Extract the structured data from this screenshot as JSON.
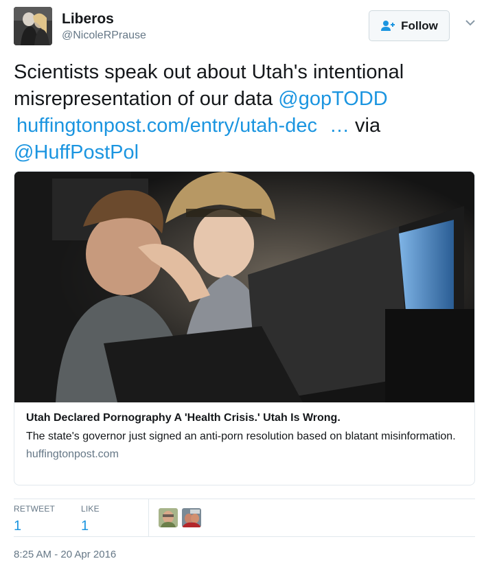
{
  "author": {
    "display_name": "Liberos",
    "handle": "@NicoleRPrause",
    "avatar_icon": "profile-photo-icon"
  },
  "follow": {
    "label": "Follow",
    "icon": "follow-person-plus-icon"
  },
  "tweet": {
    "text_1": "Scientists speak out about Utah's intentional misrepresentation of our data ",
    "mention_1": "@gopTODD",
    "url": "huffingtonpost.com/entry/utah-dec",
    "ellipsis": "…",
    "via": " via ",
    "mention_2": "@HuffPostPol"
  },
  "card": {
    "title": "Utah Declared Pornography A 'Health Crisis.' Utah Is Wrong.",
    "description": "The state's governor just signed an anti-porn resolution based on blatant misinformation.",
    "domain": "huffingtonpost.com"
  },
  "stats": {
    "retweet_label": "RETWEET",
    "retweet_count": "1",
    "like_label": "LIKE",
    "like_count": "1"
  },
  "timestamp": "8:25 AM - 20 Apr 2016",
  "colors": {
    "link": "#1b95e0",
    "text": "#14171a",
    "secondary": "#657786",
    "border": "#e1e8ed"
  }
}
